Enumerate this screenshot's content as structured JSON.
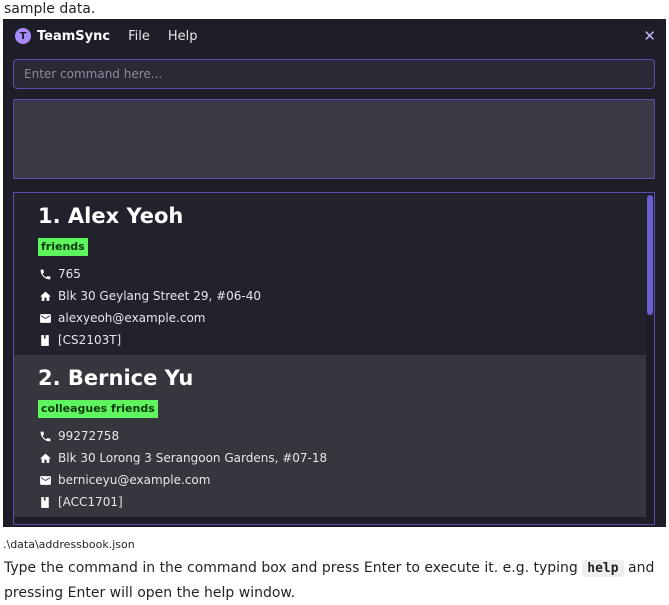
{
  "doc": {
    "top_text": "sample data.",
    "bottom_text_before": "Type the command in the command box and press Enter to execute it. e.g. typing ",
    "bottom_code": "help",
    "bottom_text_after": " and pressing Enter will open the help window."
  },
  "app": {
    "logo_letter": "T",
    "name": "TeamSync",
    "menu": [
      "File",
      "Help"
    ],
    "close_glyph": "✕"
  },
  "command": {
    "placeholder": "Enter command here...",
    "value": ""
  },
  "result": {
    "text": ""
  },
  "persons": [
    {
      "index_name": "1. Alex Yeoh",
      "tags": [
        "friends"
      ],
      "phone": "765",
      "address": "Blk 30 Geylang Street 29, #06-40",
      "email": "alexyeoh@example.com",
      "module": "[CS2103T]"
    },
    {
      "index_name": "2. Bernice Yu",
      "tags": [
        "colleagues friends"
      ],
      "phone": "99272758",
      "address": "Blk 30 Lorong 3 Serangoon Gardens, #07-18",
      "email": "berniceyu@example.com",
      "module": "[ACC1701]"
    }
  ],
  "status": {
    "file_path": ".\\data\\addressbook.json"
  },
  "colors": {
    "window_bg": "#1e1e28",
    "accent": "#5a4fb0",
    "tag_bg": "#5ff55f"
  },
  "icons": {
    "phone": "phone-icon",
    "address": "home-icon",
    "email": "mail-icon",
    "module": "book-icon"
  }
}
